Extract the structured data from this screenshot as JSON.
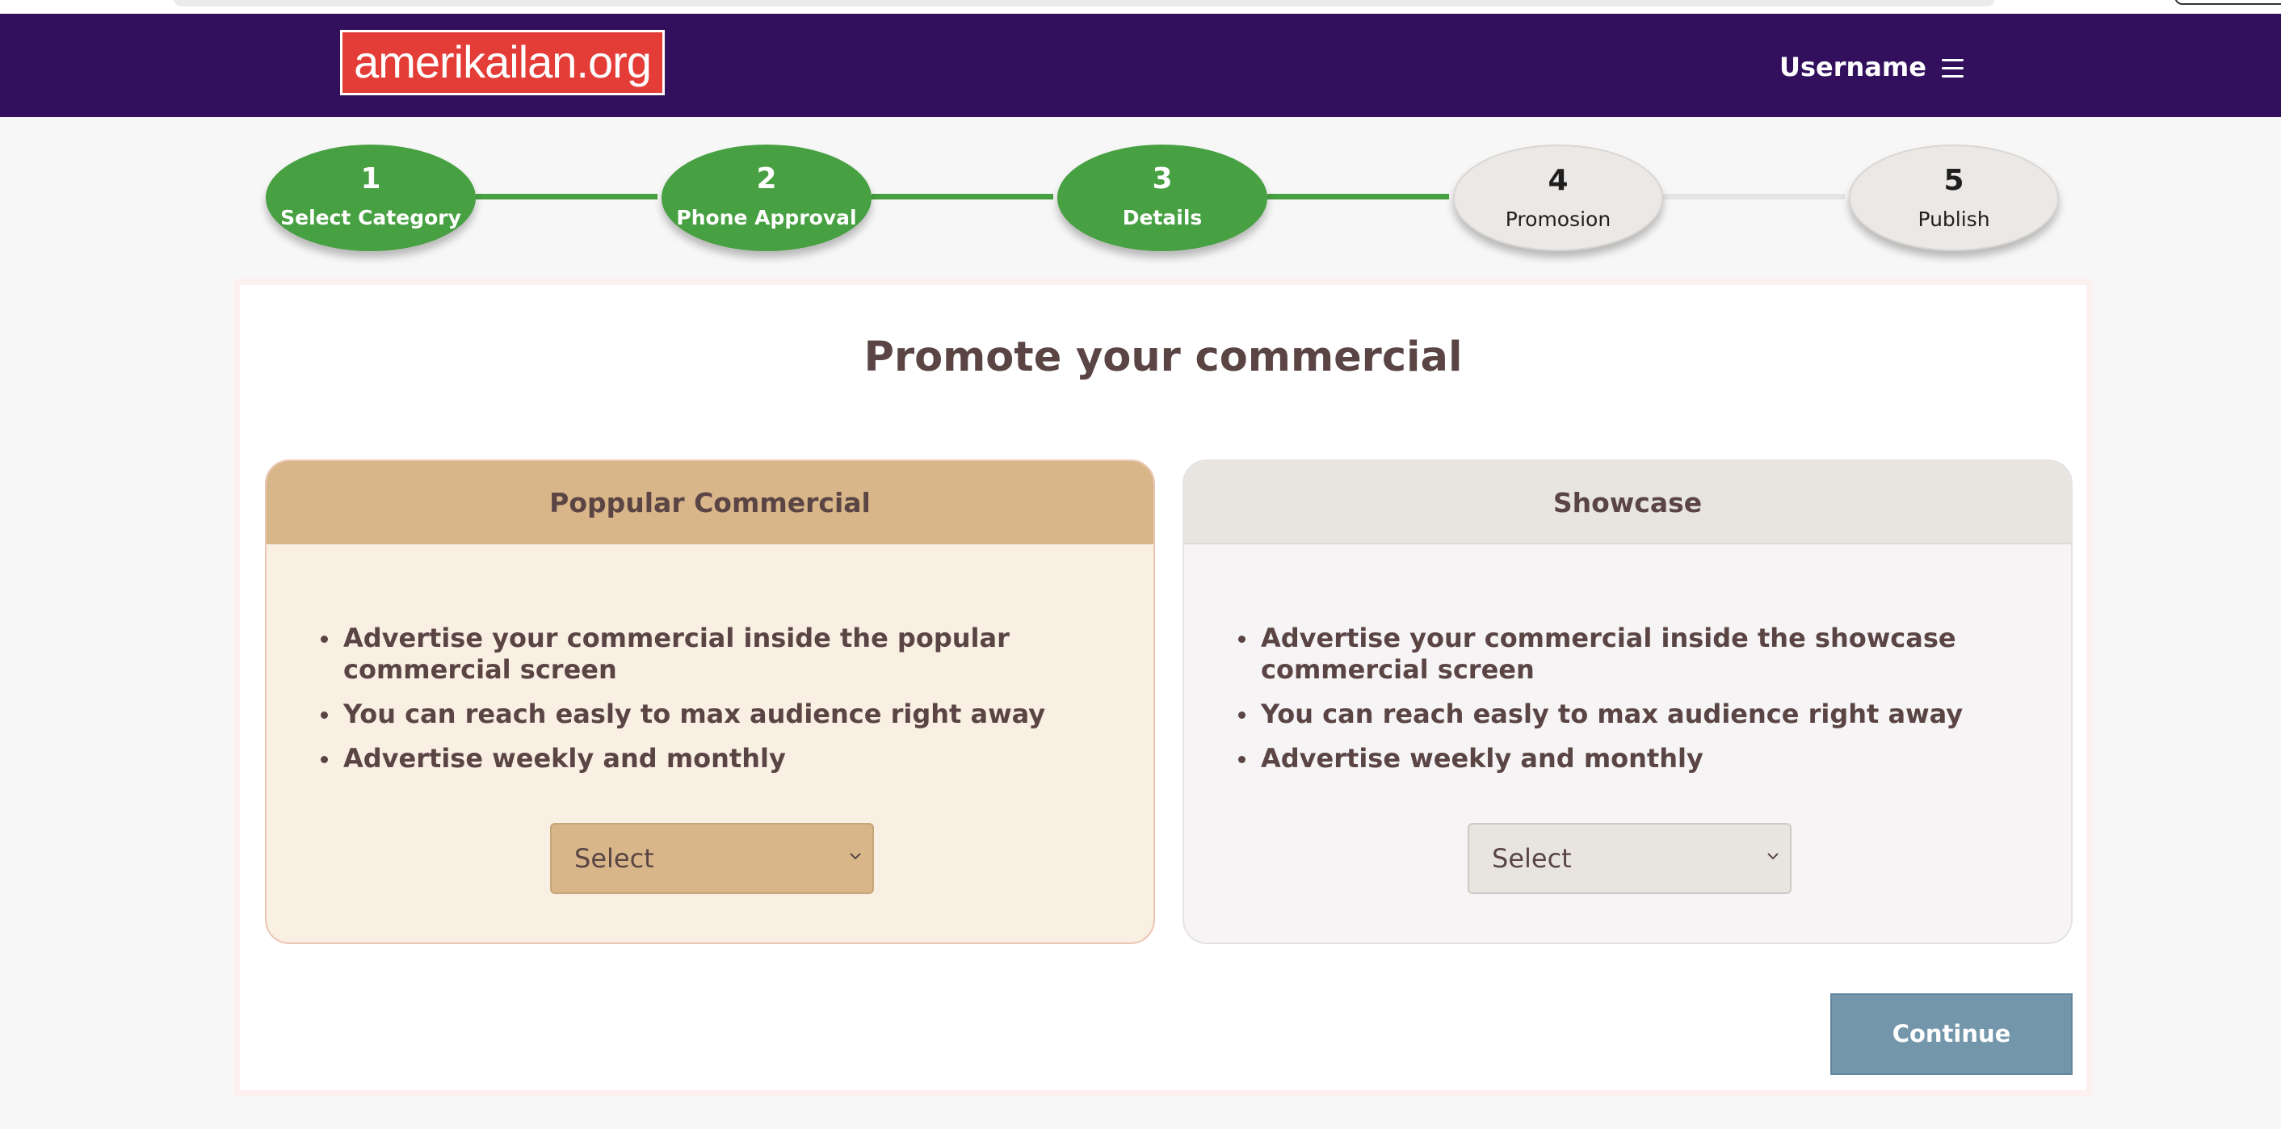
{
  "header": {
    "logo_text": "amerikailan.org",
    "username": "Username",
    "menu_icon": "hamburger-menu-icon",
    "background_color": "#32105e",
    "logo_color": "#e43d38"
  },
  "stepper": {
    "steps": [
      {
        "number": "1",
        "label": "Select Category",
        "state": "completed"
      },
      {
        "number": "2",
        "label": "Phone Approval",
        "state": "completed"
      },
      {
        "number": "3",
        "label": "Details",
        "state": "completed"
      },
      {
        "number": "4",
        "label": "Promosion",
        "state": "current"
      },
      {
        "number": "5",
        "label": "Publish",
        "state": "pending"
      }
    ],
    "completed_color": "#47a041",
    "pending_color": "#ebe8e6"
  },
  "main": {
    "title": "Promote your commercial",
    "options": [
      {
        "header": "Poppular Commercial",
        "bullets": [
          "Advertise your commercial inside the popular commercial screen",
          "You can reach easly to max audience right away",
          "Advertise weekly and monthly"
        ],
        "select_value": "Select",
        "accent_color": "#d8b68a"
      },
      {
        "header": "Showcase",
        "bullets": [
          "Advertise your commercial inside the showcase commercial screen",
          "You can reach easly to max audience right away",
          "Advertise weekly and monthly"
        ],
        "select_value": "Select",
        "accent_color": "#e8e5e0"
      }
    ],
    "continue_label": "Continue",
    "continue_color": "#7396ab"
  }
}
